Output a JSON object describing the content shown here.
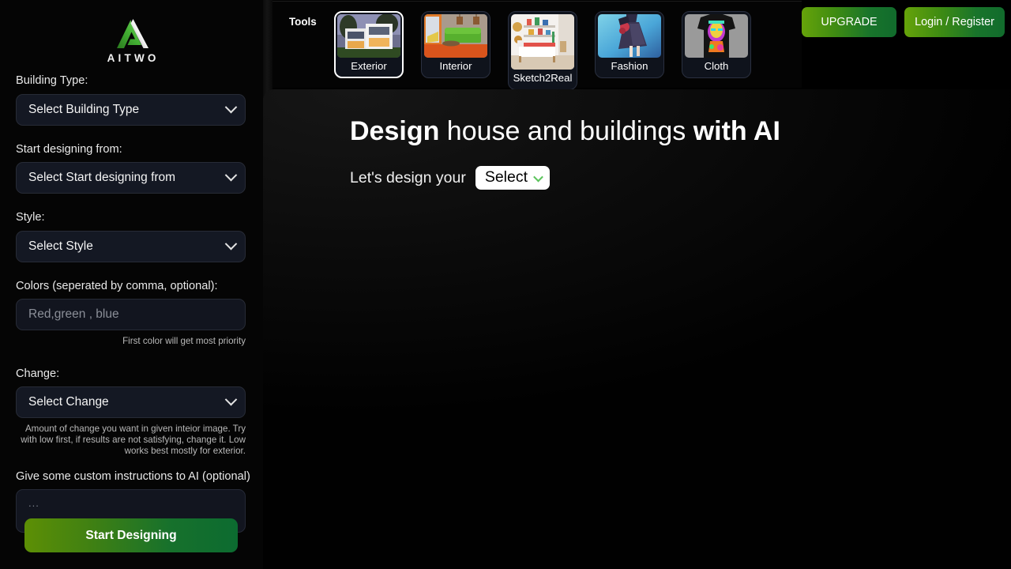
{
  "brand": {
    "name": "AITWO",
    "logo_icon": "triangle-logo-icon",
    "green": "#3fa02c",
    "silver": "#e0e0e0"
  },
  "sidebar": {
    "fields": [
      {
        "label": "Building Type:",
        "control": "select",
        "value": "Select Building Type",
        "name": "building-type"
      },
      {
        "label": "Start designing from:",
        "control": "select",
        "value": "Select Start designing from",
        "name": "start-designing-from"
      },
      {
        "label": "Style:",
        "control": "select",
        "value": "Select Style",
        "name": "style"
      }
    ],
    "colors_field": {
      "label": "Colors (seperated by comma, optional):",
      "placeholder": "Red,green , blue",
      "hint": "First color will get most priority"
    },
    "change_field": {
      "label": "Change:",
      "value": "Select Change",
      "hint": "Amount of change you want in given inteior image. Try with low first, if results are not satisfying, change it. Low works best mostly for exterior."
    },
    "instructions_field": {
      "label": "Give some custom instructions to AI (optional)",
      "placeholder": "..."
    },
    "submit_label": "Start Designing"
  },
  "toolbar": {
    "title": "Tools",
    "tools": [
      {
        "label": "Exterior",
        "selected": true,
        "thumb": "modern-house-exterior-photo"
      },
      {
        "label": "Interior",
        "selected": false,
        "thumb": "green-sofa-living-room-photo"
      },
      {
        "label": "Sketch2Real",
        "selected": false,
        "thumb": "white-bedroom-sketch-photo"
      },
      {
        "label": "Fashion",
        "selected": false,
        "thumb": "fashion-dress-illustration"
      },
      {
        "label": "Cloth",
        "selected": false,
        "thumb": "neon-print-tshirt-photo"
      }
    ],
    "upgrade_label": "UPGRADE",
    "login_label": "Login / Register",
    "button_gradient": [
      "#66a30a",
      "#116b2c"
    ]
  },
  "hero": {
    "title_part1": "Design",
    "title_part2": " house and buildings ",
    "title_part3": "with AI",
    "subtitle": "Let's design your",
    "select_value": "Select",
    "select_chevron_color": "#5cc45c"
  }
}
